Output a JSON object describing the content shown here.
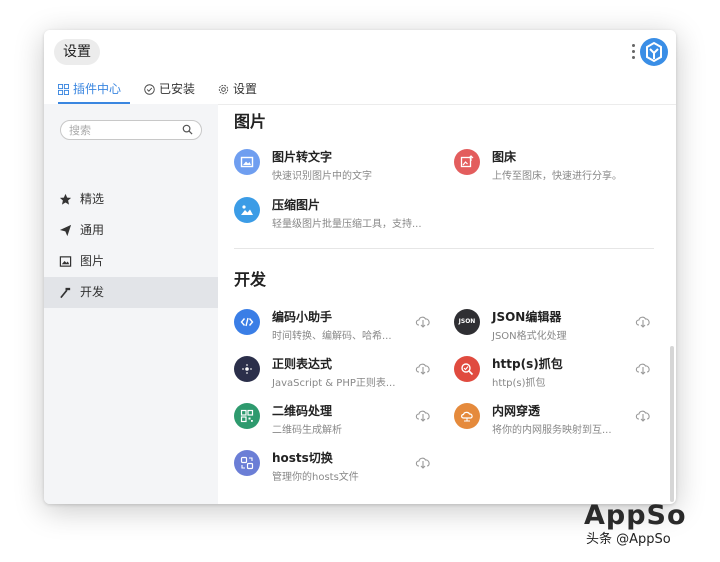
{
  "window": {
    "title": "设置"
  },
  "tabs": [
    {
      "label": "插件中心",
      "icon": "grid-icon",
      "active": true
    },
    {
      "label": "已安装",
      "icon": "check-circle-icon",
      "active": false
    },
    {
      "label": "设置",
      "icon": "gear-icon",
      "active": false
    }
  ],
  "sidebar": {
    "search_placeholder": "搜索",
    "items": [
      {
        "label": "精选",
        "icon": "star-icon"
      },
      {
        "label": "通用",
        "icon": "paper-plane-icon"
      },
      {
        "label": "图片",
        "icon": "image-icon"
      },
      {
        "label": "开发",
        "icon": "hammer-icon",
        "active": true
      }
    ]
  },
  "sections": [
    {
      "title": "图片",
      "plugins": [
        {
          "name": "图片转文字",
          "desc": "快速识别图片中的文字",
          "icon": "image-icon",
          "color": "#6f9ef0"
        },
        {
          "name": "图床",
          "desc": "上传至图床，快速进行分享。",
          "icon": "upload-image-icon",
          "color": "#e35d5d"
        },
        {
          "name": "压缩图片",
          "desc": "轻量级图片批量压缩工具，支持...",
          "icon": "landscape-icon",
          "color": "#3b9ce6"
        }
      ]
    },
    {
      "title": "开发",
      "plugins": [
        {
          "name": "编码小助手",
          "desc": "时间转换、编解码、哈希...",
          "icon": "code-icon",
          "color": "#3a7ee6"
        },
        {
          "name": "JSON编辑器",
          "desc": "JSON格式化处理",
          "icon": "json-icon",
          "icon_text": "JSON",
          "color": "#2f2f33"
        },
        {
          "name": "正则表达式",
          "desc": "JavaScript & PHP正则表...",
          "icon": "regex-icon",
          "color": "#2b2f4a"
        },
        {
          "name": "http(s)抓包",
          "desc": "http(s)抓包",
          "icon": "capture-icon",
          "color": "#e04b3f"
        },
        {
          "name": "二维码处理",
          "desc": "二维码生成解析",
          "icon": "qrcode-icon",
          "color": "#2e9a6e"
        },
        {
          "name": "内网穿透",
          "desc": "将你的内网服务映射到互...",
          "icon": "cloud-network-icon",
          "color": "#e58a3c"
        },
        {
          "name": "hosts切换",
          "desc": "管理你的hosts文件",
          "icon": "switch-icon",
          "color": "#6b7ed6"
        }
      ]
    }
  ],
  "watermark": {
    "logo": "AppSo",
    "text": "头条 @AppSo"
  }
}
